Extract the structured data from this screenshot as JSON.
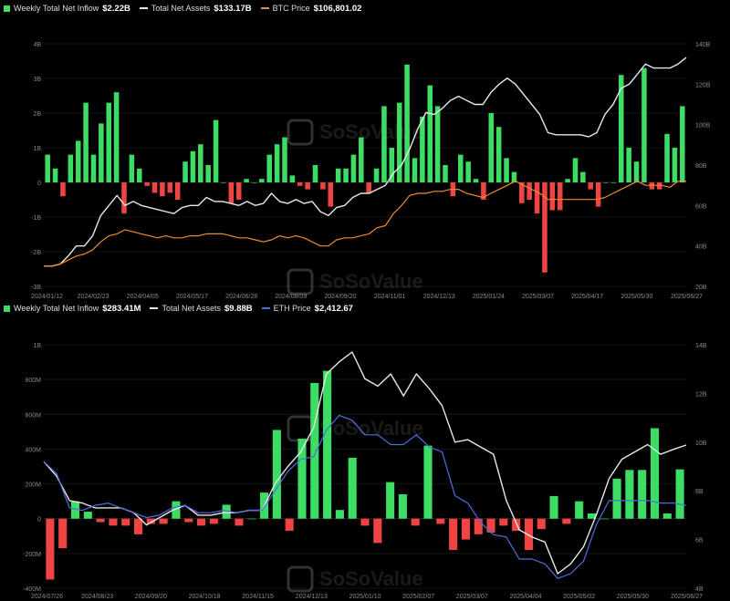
{
  "colors": {
    "inflow_positive": "#3ddc64",
    "inflow_negative": "#ee4444",
    "total_assets_line": "#e8e8e8",
    "btc_price_line": "#f08a2c",
    "eth_price_line": "#4f6fe0",
    "background": "#000000"
  },
  "watermark": "SoSoValue",
  "charts": [
    {
      "id": "btc",
      "legend": [
        {
          "label": "Weekly Total Net Inflow",
          "value": "$2.22B",
          "swatch": "square",
          "color": "#3ddc64"
        },
        {
          "label": "Total Net Assets",
          "value": "$133.17B",
          "swatch": "line",
          "color": "#e8e8e8"
        },
        {
          "label": "BTC Price",
          "value": "$106,801.02",
          "swatch": "line",
          "color": "#f08a2c"
        }
      ],
      "left_ticks": [
        {
          "v": 4,
          "t": "4B"
        },
        {
          "v": 3,
          "t": "3B"
        },
        {
          "v": 2,
          "t": "2B"
        },
        {
          "v": 1,
          "t": "1B"
        },
        {
          "v": 0,
          "t": "0"
        },
        {
          "v": -1,
          "t": "-1B"
        },
        {
          "v": -2,
          "t": "-2B"
        },
        {
          "v": -3,
          "t": "-3B"
        }
      ],
      "right_ticks": [
        {
          "v": 140,
          "t": "140B"
        },
        {
          "v": 120,
          "t": "120B"
        },
        {
          "v": 100,
          "t": "100B"
        },
        {
          "v": 80,
          "t": "80B"
        },
        {
          "v": 60,
          "t": "60B"
        },
        {
          "v": 40,
          "t": "40B"
        },
        {
          "v": 20,
          "t": "20B"
        }
      ],
      "x_labels": [
        "2024/01/12",
        "2024/02/23",
        "2024/04/05",
        "2024/05/17",
        "2024/06/28",
        "2024/08/09",
        "2024/09/20",
        "2024/11/01",
        "2024/12/13",
        "2025/01/24",
        "2025/03/07",
        "2025/04/17",
        "2025/05/30",
        "2025/06/27"
      ]
    },
    {
      "id": "eth",
      "legend": [
        {
          "label": "Weekly Total Net Inflow",
          "value": "$283.41M",
          "swatch": "square",
          "color": "#3ddc64"
        },
        {
          "label": "Total Net Assets",
          "value": "$9.88B",
          "swatch": "line",
          "color": "#e8e8e8"
        },
        {
          "label": "ETH Price",
          "value": "$2,412.67",
          "swatch": "line",
          "color": "#4f6fe0"
        }
      ],
      "left_ticks": [
        {
          "v": 1000,
          "t": "1B"
        },
        {
          "v": 800,
          "t": "800M"
        },
        {
          "v": 600,
          "t": "600M"
        },
        {
          "v": 400,
          "t": "400M"
        },
        {
          "v": 200,
          "t": "200M"
        },
        {
          "v": 0,
          "t": "0"
        },
        {
          "v": -200,
          "t": "-200M"
        },
        {
          "v": -400,
          "t": "-400M"
        }
      ],
      "right_ticks": [
        {
          "v": 14,
          "t": "14B"
        },
        {
          "v": 12,
          "t": "12B"
        },
        {
          "v": 10,
          "t": "10B"
        },
        {
          "v": 8,
          "t": "8B"
        },
        {
          "v": 6,
          "t": "6B"
        },
        {
          "v": 4,
          "t": "4B"
        }
      ],
      "x_labels": [
        "2024/07/26",
        "2024/08/23",
        "2024/09/20",
        "2024/10/18",
        "2024/11/15",
        "2024/12/13",
        "2025/01/10",
        "2025/02/07",
        "2025/03/07",
        "2025/04/04",
        "2025/05/02",
        "2025/05/30",
        "2025/06/27"
      ]
    }
  ],
  "chart_data": [
    {
      "type": "bar",
      "title": "",
      "xlabel": "",
      "ylabel": "",
      "ylim": [
        -3,
        4
      ],
      "y2lim": [
        20,
        140
      ],
      "unit_left": "USD billions",
      "unit_right": "USD billions",
      "series": [
        {
          "name": "Weekly Total Net Inflow",
          "axis": "left",
          "kind": "bar",
          "values": [
            0.8,
            0.4,
            -0.4,
            0.8,
            1.2,
            2.3,
            0.8,
            1.7,
            2.3,
            2.6,
            -0.9,
            0.8,
            0.4,
            -0.1,
            -0.3,
            -0.4,
            -0.3,
            -0.5,
            0.6,
            0.9,
            1.1,
            0.5,
            1.8,
            0.0,
            -0.6,
            -0.5,
            0.1,
            0.0,
            0.1,
            0.8,
            1.1,
            1.3,
            0.2,
            -0.1,
            -0.2,
            0.5,
            -0.2,
            -0.7,
            0.4,
            0.4,
            0.8,
            1.3,
            -0.3,
            0.4,
            2.2,
            1.0,
            2.3,
            3.4,
            0.7,
            1.9,
            2.8,
            2.2,
            0.5,
            -0.4,
            0.8,
            0.6,
            0.1,
            -0.5,
            2.0,
            1.6,
            0.7,
            0.3,
            -0.6,
            -0.5,
            -0.9,
            -2.6,
            -0.8,
            -0.8,
            0.1,
            0.7,
            0.3,
            -0.2,
            -0.7,
            0.0,
            0.0,
            3.1,
            1.0,
            0.6,
            3.3,
            -0.2,
            -0.2,
            1.4,
            1.0,
            2.2
          ]
        },
        {
          "name": "Total Net Assets",
          "axis": "right",
          "kind": "line",
          "values": [
            30,
            30,
            31,
            35,
            40,
            40,
            45,
            55,
            60,
            65,
            60,
            62,
            60,
            59,
            58,
            57,
            56,
            59,
            60,
            60,
            64,
            62,
            62,
            61,
            60,
            62,
            60,
            61,
            66,
            62,
            61,
            63,
            61,
            62,
            57,
            55,
            59,
            60,
            64,
            66,
            66,
            68,
            70,
            76,
            80,
            88,
            98,
            106,
            105,
            108,
            112,
            114,
            112,
            110,
            110,
            116,
            120,
            123,
            120,
            115,
            110,
            105,
            96,
            95,
            95,
            95,
            95,
            94,
            96,
            105,
            110,
            118,
            120,
            125,
            130,
            128,
            128,
            128,
            130,
            133.17
          ]
        },
        {
          "name": "BTC Price",
          "axis": "right",
          "kind": "line",
          "values": [
            30,
            30,
            31,
            33,
            35,
            36,
            38,
            42,
            45,
            46,
            48,
            47,
            46,
            45,
            44,
            45,
            44,
            44,
            45,
            45,
            46,
            46,
            46,
            45,
            44,
            44,
            43,
            42,
            43,
            45,
            44,
            45,
            44,
            42,
            40,
            40,
            43,
            44,
            44,
            45,
            46,
            49,
            50,
            56,
            60,
            65,
            66,
            66,
            67,
            67,
            68,
            68,
            66,
            65,
            64,
            66,
            68,
            70,
            72,
            70,
            68,
            66,
            63,
            63,
            63,
            63,
            63,
            63,
            63,
            64,
            66,
            68,
            70,
            72,
            70,
            70,
            70,
            69,
            72,
            72
          ]
        }
      ]
    },
    {
      "type": "bar",
      "title": "",
      "xlabel": "",
      "ylabel": "",
      "ylim": [
        -400,
        1000
      ],
      "y2lim": [
        4,
        14
      ],
      "unit_left": "USD millions",
      "unit_right": "USD billions",
      "series": [
        {
          "name": "Weekly Total Net Inflow",
          "axis": "left",
          "kind": "bar",
          "values": [
            -350,
            -170,
            100,
            40,
            -20,
            -40,
            -40,
            -90,
            -30,
            -30,
            100,
            -20,
            -40,
            -30,
            80,
            -40,
            0,
            150,
            510,
            -70,
            460,
            780,
            850,
            50,
            350,
            -40,
            -140,
            210,
            140,
            -40,
            420,
            -30,
            -180,
            -120,
            -90,
            -80,
            -40,
            -70,
            -180,
            -60,
            130,
            -30,
            100,
            30,
            0,
            230,
            280,
            280,
            520,
            30,
            283.41
          ]
        },
        {
          "name": "Total Net Assets",
          "axis": "right",
          "kind": "line",
          "values": [
            9.2,
            8.6,
            7.6,
            7.5,
            7.3,
            7.3,
            7.3,
            7.1,
            6.6,
            6.9,
            7.2,
            7.4,
            7.0,
            7.0,
            7.1,
            7.1,
            7.2,
            7.2,
            8.3,
            9.0,
            9.6,
            10.6,
            12.8,
            13.3,
            13.7,
            12.6,
            12.3,
            12.8,
            11.9,
            12.8,
            12.2,
            11.5,
            10.0,
            10.1,
            9.8,
            9.5,
            7.6,
            6.4,
            6.1,
            5.9,
            4.6,
            5.0,
            5.7,
            7.0,
            8.5,
            9.3,
            9.6,
            9.9,
            9.5,
            9.7,
            9.88
          ]
        },
        {
          "name": "ETH Price",
          "axis": "right",
          "kind": "line",
          "values": [
            9.2,
            8.7,
            7.3,
            7.2,
            7.4,
            7.5,
            7.3,
            7.1,
            6.9,
            7.0,
            7.3,
            7.4,
            7.1,
            7.1,
            7.2,
            7.1,
            7.2,
            7.2,
            8.0,
            8.8,
            9.3,
            9.4,
            10.5,
            11.1,
            10.9,
            10.3,
            10.3,
            9.9,
            9.9,
            10.3,
            9.8,
            9.6,
            7.8,
            7.5,
            6.7,
            6.2,
            6.1,
            5.2,
            5.2,
            5.0,
            4.4,
            4.6,
            5.1,
            6.6,
            7.6,
            7.6,
            7.6,
            7.6,
            7.5,
            7.5,
            7.4
          ]
        }
      ]
    }
  ]
}
